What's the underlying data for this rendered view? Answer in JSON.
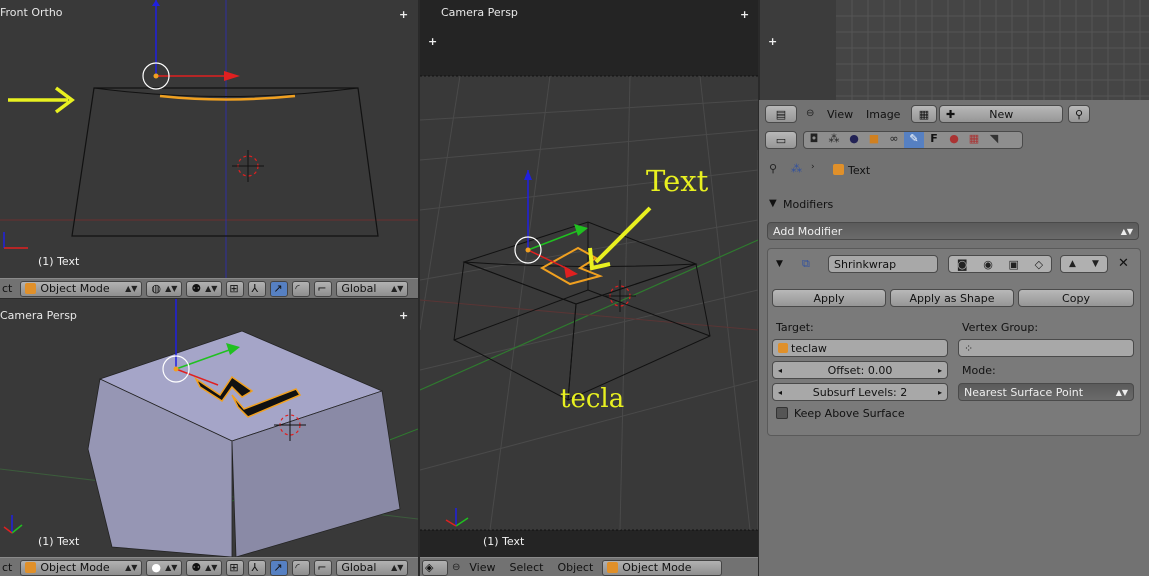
{
  "viewports": {
    "front_ortho": {
      "label": "Front Ortho",
      "object_label": "(1) Text"
    },
    "camera_left": {
      "label": "Camera Persp",
      "object_label": "(1) Text"
    },
    "camera_main": {
      "label": "Camera Persp",
      "object_label": "(1) Text",
      "annotation_text": "Text",
      "annotation_tecla": "tecla"
    },
    "uv_editor": {}
  },
  "header_left_top": {
    "mode": "Object Mode",
    "orientation": "Global"
  },
  "header_left_bottom": {
    "mode": "Object Mode",
    "orientation": "Global"
  },
  "header_main": {
    "menu_view": "View",
    "menu_select": "Select",
    "menu_object": "Object",
    "mode": "Object Mode"
  },
  "image_header": {
    "menu_view": "View",
    "menu_image": "Image",
    "new_label": "New"
  },
  "properties": {
    "breadcrumb_object": "Text",
    "section_title": "Modifiers",
    "add_modifier": "Add Modifier",
    "modifier_name": "Shrinkwrap",
    "apply": "Apply",
    "apply_as_shape": "Apply as Shape",
    "copy": "Copy",
    "target_label": "Target:",
    "target_value": "teclaw",
    "vertex_group_label": "Vertex Group:",
    "offset": "Offset: 0.00",
    "subsurf": "Subsurf Levels: 2",
    "mode_label": "Mode:",
    "mode_value": "Nearest Surface Point",
    "keep_above": "Keep Above Surface"
  },
  "colors": {
    "viewport_bg": "#393939",
    "header_bg": "#727272",
    "annotation_yellow": "#e8f020",
    "selection_orange": "#f0a020",
    "axis_red": "#e02020",
    "axis_green": "#20c020",
    "axis_blue": "#2020e0"
  }
}
